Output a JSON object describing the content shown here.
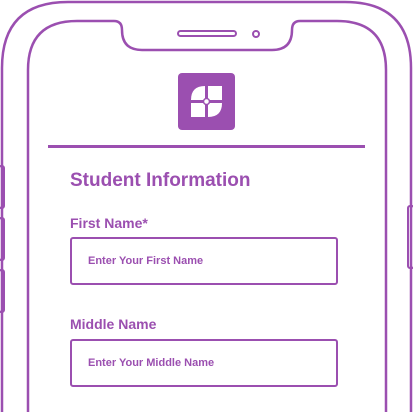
{
  "form": {
    "section_title": "Student Information",
    "fields": [
      {
        "label": "First Name*",
        "value": "",
        "placeholder": "Enter Your First Name"
      },
      {
        "label": "Middle Name",
        "value": "",
        "placeholder": "Enter Your Middle Name"
      }
    ]
  },
  "icons": {
    "logo": "app-logo-icon",
    "speaker": "speaker-grille-icon",
    "camera": "front-camera-icon"
  },
  "colors": {
    "accent": "#9b4fb0",
    "background": "#ffffff"
  }
}
